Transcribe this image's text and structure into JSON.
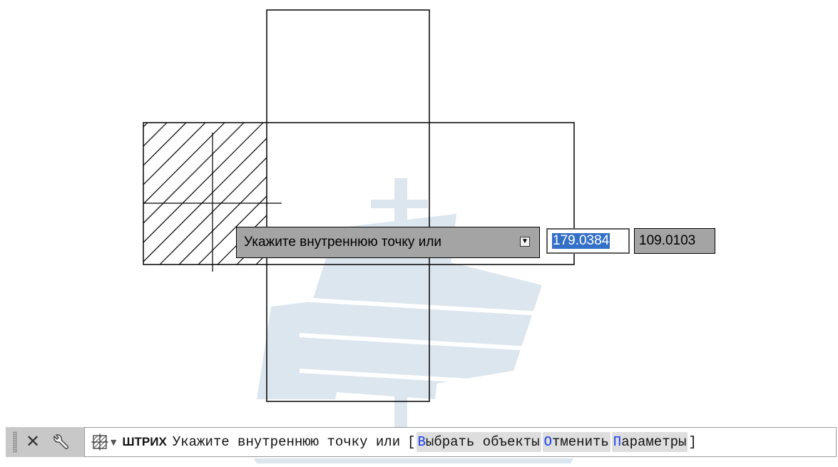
{
  "drawing": {
    "prompt_label": "Укажите внутреннюю точку или",
    "prompt_options_icon": "down-arrow-box-icon",
    "coord_x": "179.0384",
    "coord_y": "109.0103"
  },
  "command_line": {
    "close_icon": "close-icon",
    "settings_icon": "wrench-icon",
    "command_icon": "hatch-icon",
    "command_name": "ШТРИХ",
    "prompt_text": "Укажите внутреннюю точку или",
    "bracket_open": "[",
    "bracket_close": "]",
    "options": [
      {
        "key": "В",
        "rest": "ыбрать объекты"
      },
      {
        "key": "О",
        "rest": "тменить"
      },
      {
        "key": "П",
        "rest": "араметры"
      }
    ]
  },
  "colors": {
    "tooltip_bg": "#a4a4a4",
    "selection": "#3470c8",
    "option_key": "#1a3ee8",
    "watermark": "#dce6ef"
  }
}
